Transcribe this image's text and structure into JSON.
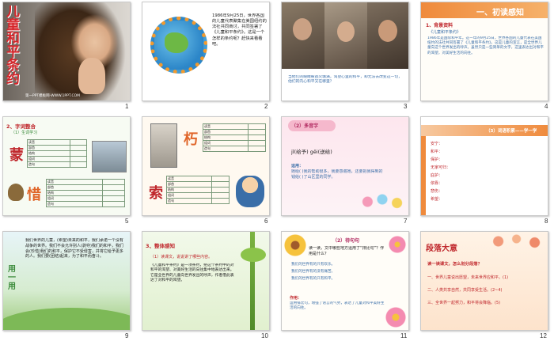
{
  "slides": [
    {
      "num": "1",
      "title_vertical": "儿童和平条约",
      "footer": "第一PPT模板网-WWW.1PPT.COM"
    },
    {
      "num": "2",
      "text": "1986年9月25日，世界各国的儿童代表聚集在美国纽约的法社共同商讨，共同签署了《儿童和平条约》。这是一个怎样的条约呢？赶快来看看吧。"
    },
    {
      "num": "3",
      "caption": "当他们的眼睛被战火填满，渴望心里的和平，却无法去改变这一切，他们的内心和平又在哪里？"
    },
    {
      "num": "4",
      "title": "一、初读感知",
      "section": "1、背景资料",
      "subtitle": "《儿童和平条约》",
      "text": "1986年是国际和平年。这一年的9月25日，世界各国的儿童代表在美国纽约的法社共同签署了《儿童和平条约》。这是儿童的宣言，是全世界儿童向这个世界发出的呼声。虽然只是一些简单的文字，这里表达出对和平的渴望，对美好生活的向往。"
    },
    {
      "num": "5",
      "title": "2、字词整合",
      "sub": "（1）生词学习",
      "char1": "蒙",
      "char2": "惜",
      "rows1": [
        "读音",
        "部首",
        "结构",
        "组词",
        "造句"
      ],
      "rows2": [
        "读音",
        "部首",
        "结构",
        "组词",
        "造句"
      ]
    },
    {
      "num": "6",
      "char1": "朽",
      "char2": "索",
      "rows1": [
        "读音",
        "部首",
        "结构",
        "组词",
        "造句"
      ],
      "rows2": [
        "读音",
        "部首",
        "结构",
        "组词",
        "造句"
      ]
    },
    {
      "num": "7",
      "title": "（2）多音字",
      "pinyin": "jǐ(给予)  gěi(送给)",
      "label": "运用：",
      "text": "她给(   )我的帮助很多，我要感谢她，还要把我得到的钱给(   )了山区里的同学。"
    },
    {
      "num": "8",
      "title": "（3）词语积累——学一学",
      "items": [
        "安宁：",
        "和平：",
        "保护：",
        "无家可归：",
        "庇护：",
        "依靠：",
        "悲伤：",
        "希望："
      ]
    },
    {
      "num": "9",
      "side": "用一用",
      "text": "我们世界的儿童，(希望)未来的和平，我们承诺一个没有战争的世界。我们不会允许别人(剥夺)我们的和平，我们会(珍惜)我们的和平，保护它不受侵害，并将它给予更多的人。我们要(团结)起来，为了和平而奋斗。"
    },
    {
      "num": "10",
      "title": "3、整体感知",
      "sub": "（1）读课文，说说讲了哪些内容。",
      "text": "《儿童和平条约》是一项条约，把这个条约中的对和平的渴望、对美好生活的向往集中地表达出来。它是全世界的儿童向世界发出的呼声，作者借此表达了对和平的渴望。"
    },
    {
      "num": "11",
      "title": "（2）待句句",
      "q": "读一读，文中哪些地方运用了“排比句”？作用是什么？",
      "items": [
        "我们的世界有的只有欢乐。",
        "我们的世界有的没有痛苦。",
        "我们的世界有的只有和平。"
      ],
      "note": "作用：",
      "text": "运用排比句，增强了语言的气势，表达了儿童对和平美好生活的向往。"
    },
    {
      "num": "12",
      "title": "段落大意",
      "sub": "读一读课文，怎么划分段落？",
      "items": [
        "一、世界儿童说出愿望，未来世界应和平。(1)",
        "二、人类共享自然，共同享受生活。(2~4)",
        "三、全世界一起努力，和平将会降临。(5)"
      ]
    }
  ],
  "colors": {
    "red": "#c0282d",
    "orange_bar": "#e8772e",
    "blue_caption": "#3a6ea8"
  }
}
